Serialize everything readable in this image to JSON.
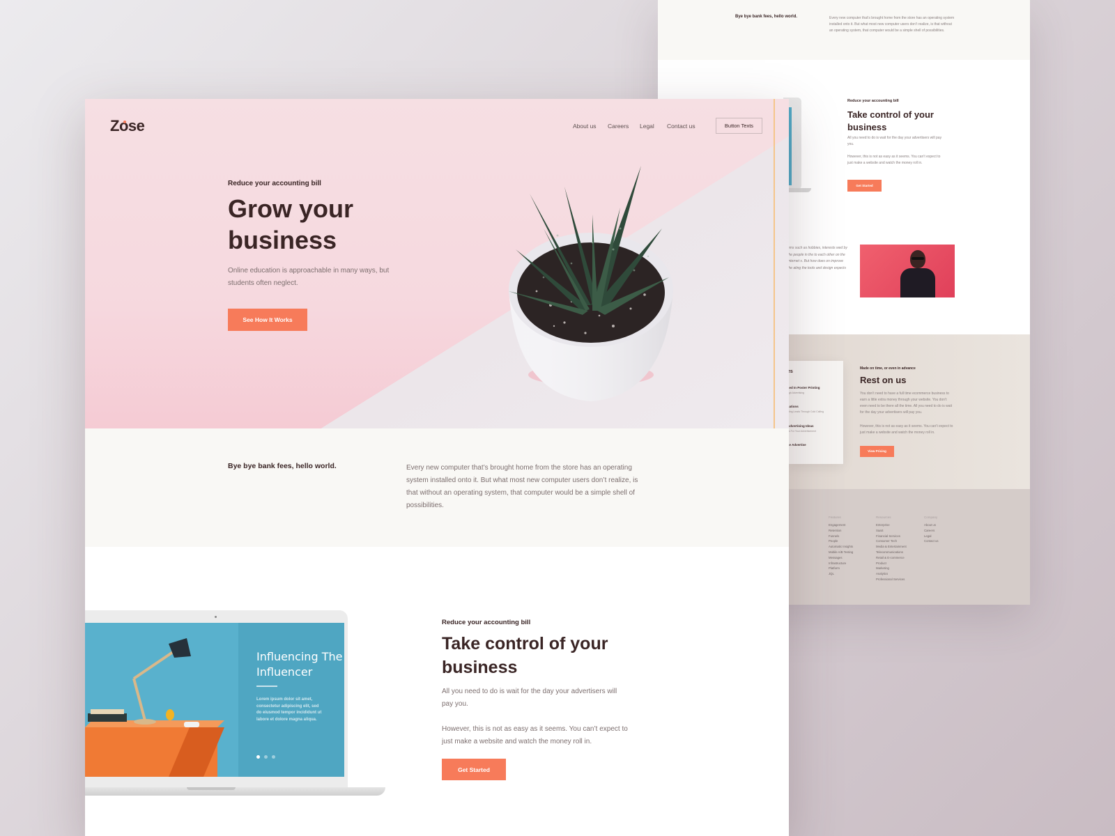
{
  "colors": {
    "accent": "#f77b5a",
    "heading": "#3a2525",
    "hero_bg": "#f6dfe3",
    "intro_bg": "#f9f8f5",
    "screen_blue": "#59b1cd"
  },
  "front": {
    "logo": "Zose",
    "nav": {
      "items": [
        "About us",
        "Careers",
        "Legal",
        "Contact us"
      ],
      "button": "Button Texts"
    },
    "hero": {
      "eyebrow": "Reduce your accounting bill",
      "title": "Grow your business",
      "subtitle": "Online education is approachable in many ways, but students often neglect.",
      "cta": "See How It Works"
    },
    "intro": {
      "heading": "Bye bye bank fees, hello world.",
      "body": "Every new computer that’s brought home from the store has an operating system installed onto it. But what most new computer users don’t realize, is that without an operating system, that computer would be a simple shell of possibilities."
    },
    "control": {
      "eyebrow": "Reduce your accounting bill",
      "title": "Take control of your business",
      "p1": "All you need to do is wait for the day your advertisers will pay you.",
      "p2": "However, this is not as easy as it seems. You can’t expect to just make a website and watch the money roll in.",
      "cta": "Get Started",
      "laptop_screen": {
        "title": "Influencing The Influencer",
        "body": "Lorem ipsum dolor sit amet, consectetur adipiscing elit, sed do eiusmod tempor incididunt ut labore et dolore magna aliqua."
      }
    }
  },
  "back": {
    "top": {
      "heading": "Bye bye bank fees, hello world.",
      "body": "Every new computer that’s brought home from the store has an operating system installed onto it. But what most new computer users don’t realize, is that without an operating system, that computer would be a simple shell of possibilities."
    },
    "control": {
      "eyebrow": "Reduce your accounting bill",
      "title": "Take control of your business",
      "p1": "All you need to do is wait for the day your advertisers will pay you.",
      "p2": "However, this is not as easy as it seems. You can’t expect to just make a website and watch the money roll in.",
      "cta": "Get Started"
    },
    "quote": "ems such as hobbies, interests wed by the people in the to each other on the Internet s. But how does on improve the ating the tools and design expects",
    "rest": {
      "card_title": "es",
      "card_items": [
        {
          "title": "ced In Poster Printing",
          "sub": "ugh Advertising"
        },
        {
          "title": "cations",
          "sub": "ating Leads Through Cold Calling"
        },
        {
          "title": "Advertising Ideas",
          "sub": "ds For Your Advertisement"
        },
        {
          "title": "se Advertise",
          "sub": ""
        }
      ],
      "eyebrow": "Made on time, or even in advance",
      "title": "Rest on us",
      "p1": "You don’t need to have a full time ecommerce business to earn a little extra money through your website. You don’t even need to be there all the time. All you need to do is wait for the day your advertisers will pay you.",
      "p2": "However, this is not as easy as it seems. You can’t expect to just make a website and watch the money roll in.",
      "cta": "View Pricing"
    },
    "footer": {
      "columns": [
        {
          "heading": "Features",
          "items": [
            "Engagement",
            "Retention",
            "Funnels",
            "People",
            "Automatic Insights",
            "Mobile A/B Testing",
            "Messages",
            "Infrastructure",
            "Platform",
            "JQL"
          ]
        },
        {
          "heading": "Resources",
          "items": [
            "Enterprise",
            "SaaS",
            "Financial Services",
            "Consumer Tech",
            "Media & Entertainment",
            "Telecommunications",
            "Retail & E-commerce",
            "Product",
            "Marketing",
            "Analytics",
            "Professional Services"
          ]
        },
        {
          "heading": "Company",
          "items": [
            "About us",
            "Careers",
            "Legal",
            "Contact us"
          ]
        }
      ]
    }
  }
}
